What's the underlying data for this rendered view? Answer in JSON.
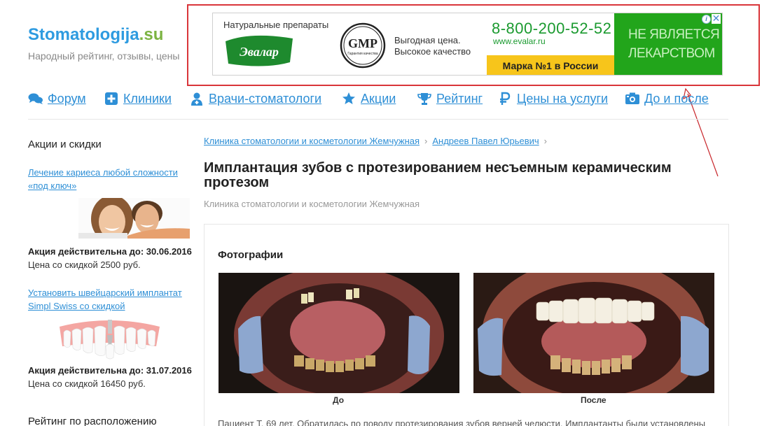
{
  "logo": {
    "name_main": "Stomatologija",
    "name_tld": ".su",
    "tagline": "Народный рейтинг, отзывы, цены"
  },
  "ad": {
    "natural": "Натуральные препараты",
    "brand": "Эвалар",
    "gmp": "GMP",
    "gmp_sub": "Гарантия качества",
    "price_line1": "Выгодная цена.",
    "price_line2": "Высокое качество",
    "phone": "8-800-200-52-52",
    "url": "www.evalar.ru",
    "marka": "Марка №1 в России",
    "notice_line1": "НЕ ЯВЛЯЕТСЯ",
    "notice_line2": "ЛЕКАРСТВОМ",
    "info": "i",
    "close": "✕"
  },
  "nav": {
    "forum": "Форум",
    "clinics": "Клиники",
    "doctors": "Врачи-стоматологи",
    "promos": "Акции",
    "rating": "Рейтинг",
    "prices": "Цены на услуги",
    "before_after": "До и после"
  },
  "sidebar": {
    "heading": "Акции и скидки",
    "promo1": {
      "link": "Лечение кариеса любой сложности «под ключ»",
      "valid": "Акция действительна до: 30.06.2016",
      "price": "Цена со скидкой 2500 руб."
    },
    "promo2": {
      "link": "Установить швейцарский имплантат Simpl Swiss со скидкой",
      "valid": "Акция действительна до: 31.07.2016",
      "price": "Цена со скидкой 16450 руб."
    },
    "heading2": "Рейтинг по расположению"
  },
  "main": {
    "breadcrumb": [
      "Клиника стоматологии и косметологии Жемчужная",
      "Андреев Павел Юрьевич"
    ],
    "breadcrumb_sep": "›",
    "title": "Имплантация зубов с протезированием несъемным керамическим протезом",
    "subtitle": "Клиника стоматологии и косметологии Жемчужная",
    "photos_heading": "Фотографии",
    "caption_before": "До",
    "caption_after": "После",
    "description": "Пациент Т. 69 лет. Обратилась по поводу протезирования зубов верней челюсти. Имплантанты были установлены"
  },
  "colors": {
    "link": "#2e8fd6",
    "ad_green": "#22a51b",
    "ad_yellow": "#f7c51b",
    "highlight_red": "#d9353a"
  }
}
